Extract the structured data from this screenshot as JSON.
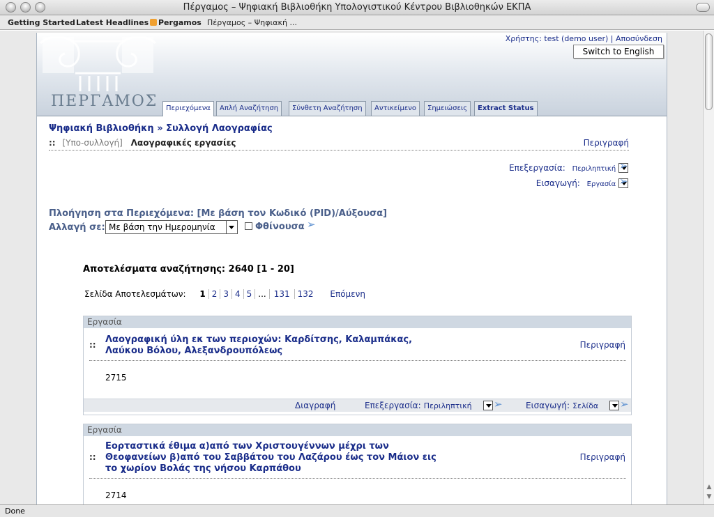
{
  "window": {
    "title": "Πέργαμος – Ψηφιακή Βιβλιοθήκη Υπολογιστικού Κέντρου Βιβλιοθηκών ΕΚΠΑ"
  },
  "bookmarks": [
    {
      "label": "Getting Started"
    },
    {
      "label": "Latest Headlines"
    },
    {
      "label": "Pergamos"
    },
    {
      "label": "Πέργαμος – Ψηφιακή ..."
    }
  ],
  "header": {
    "logo_text": "ΠΕΡΓΑΜΟΣ",
    "user_prefix": "Χρήστης:",
    "user_name": "test (demo user)",
    "separator": "|",
    "logout": "Αποσύνδεση",
    "switch_language": "Switch to English"
  },
  "tabs": [
    {
      "label": "Περιεχόμενα",
      "active": true
    },
    {
      "label": "Απλή Αναζήτηση"
    },
    {
      "label": "Σύνθετη Αναζήτηση"
    },
    {
      "label": "Αντικείμενο"
    },
    {
      "label": "Σημειώσεις"
    },
    {
      "label": "Extract Status"
    }
  ],
  "breadcrumb": {
    "root": "Ψηφιακή Βιβλιοθήκη",
    "sep": "»",
    "collection": "Συλλογή Λαογραφίας"
  },
  "subcollection": {
    "dots": "::",
    "label": "[Υπο-συλλογή]",
    "name": "Λαογραφικές εργασίες",
    "description": "Περιγραφή"
  },
  "options": {
    "edit_label": "Επεξεργασία:",
    "edit_value": "Περιληπτική",
    "import_label": "Εισαγωγή:",
    "import_value": "Εργασία"
  },
  "navigation": {
    "prefix": "Πλοήγηση στα Περιεχόμενα:",
    "criteria": "[Με βάση τον Κωδικό (PID)/Αύξουσα]",
    "change_label": "Αλλαγή σε:",
    "change_value": "Με βάση την Ημερομηνία",
    "descending": "Φθίνουσα"
  },
  "results": {
    "label": "Αποτελέσματα αναζήτησης:",
    "count": "2640",
    "range": "[1 - 20]"
  },
  "pager": {
    "label": "Σελίδα Αποτελεσμάτων:",
    "pages": [
      "1",
      "2",
      "3",
      "4",
      "5"
    ],
    "ellipsis": "...",
    "last_pages": [
      "131",
      "132"
    ],
    "next": "Επόμενη"
  },
  "items": [
    {
      "type": "Εργασία",
      "title_lines": [
        "Λαογραφική ύλη εκ των περιοχών: Καρδίτσης, Καλαμπάκας,",
        "Λαύκου Βόλου, Αλεξανδρουπόλεως"
      ],
      "description": "Περιγραφή",
      "number": "2715",
      "delete": "Διαγραφή",
      "edit_label": "Επεξεργασία:",
      "edit_value": "Περιληπτική",
      "import_label": "Εισαγωγή:",
      "import_value": "Σελίδα"
    },
    {
      "type": "Εργασία",
      "title_lines": [
        "Εορταστικά έθιμα α)από των Χριστουγέννων μέχρι των",
        "Θεοφανείων β)από του Σαββάτου του Λαζάρου έως τον Μάιον εις",
        "το χωρίον Βολάς της νήσου Καρπάθου"
      ],
      "description": "Περιγραφή",
      "number": "2714"
    }
  ],
  "status_bar": {
    "text": "Done"
  }
}
